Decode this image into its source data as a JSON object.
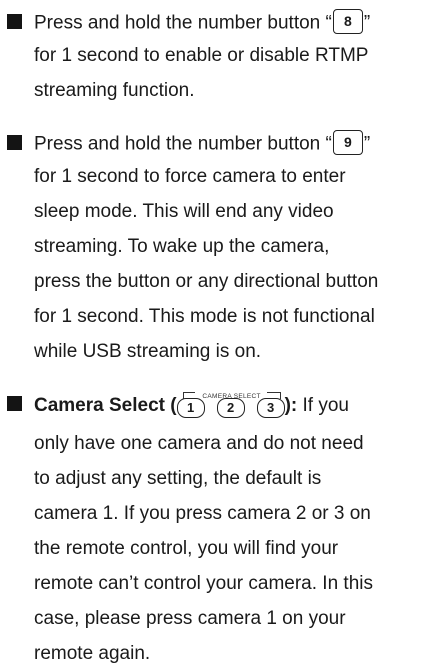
{
  "item8": {
    "line1_prefix": "Press and hold the number button “",
    "key": "8",
    "line1_suffix": "”",
    "line2": "for 1 second to enable or disable RTMP",
    "line3": "streaming function."
  },
  "item9": {
    "line1_prefix": "Press and hold the number button “",
    "key": "9",
    "line1_suffix": "”",
    "line2": "for 1 second to force camera to enter",
    "line3": "sleep mode. This will end any video",
    "line4": "streaming. To wake up the camera,",
    "line5": "press the button or any directional button",
    "line6": "for 1 second. This mode is not functional",
    "line7": "while USB streaming is on."
  },
  "camera_select": {
    "title": "Camera Select (",
    "caption": "CAMERA SELECT",
    "buttons": [
      "1",
      "2",
      "3"
    ],
    "title_end": "):",
    "line1_rest": " If you",
    "line2": "only have one camera and do not need",
    "line3": "to adjust any setting, the default is",
    "line4": "camera 1. If you press camera 2 or 3 on",
    "line5": "the remote control, you will find your",
    "line6": "remote can’t control your camera. In this",
    "line7": "case, please press camera 1 on your",
    "line8": "remote again."
  }
}
